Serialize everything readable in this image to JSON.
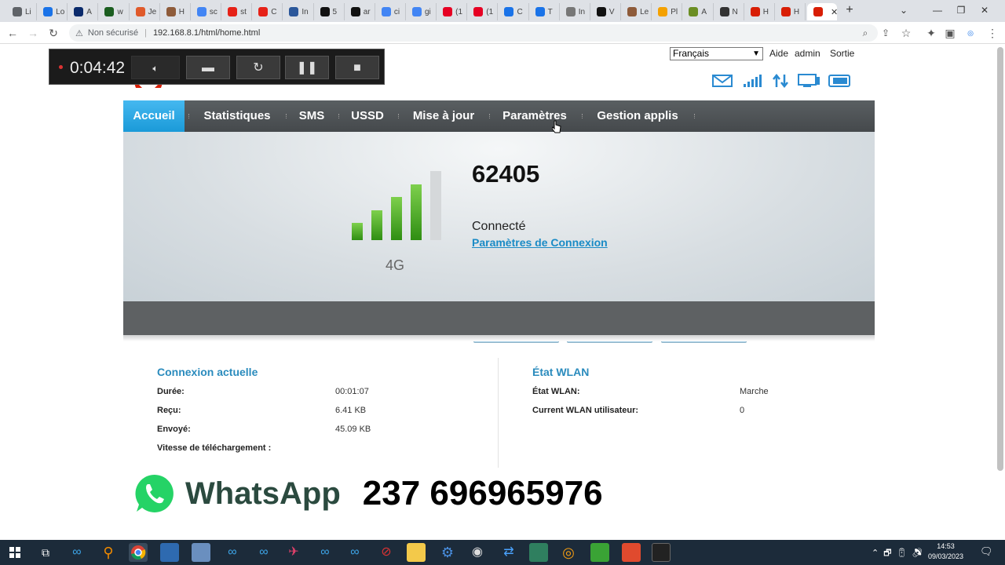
{
  "browser": {
    "tabs": [
      {
        "label": "Li",
        "color": "#5f6368"
      },
      {
        "label": "Lo",
        "color": "#1a73e8"
      },
      {
        "label": "A",
        "color": "#0a2a6b"
      },
      {
        "label": "w",
        "color": "#1b5e20"
      },
      {
        "label": "Je",
        "color": "#e05a2b"
      },
      {
        "label": "H",
        "color": "#8e5b3a"
      },
      {
        "label": "sc",
        "color": "#4285f4"
      },
      {
        "label": "st",
        "color": "#e62117"
      },
      {
        "label": "C",
        "color": "#e62117"
      },
      {
        "label": "In",
        "color": "#2b579a"
      },
      {
        "label": "5",
        "color": "#111111"
      },
      {
        "label": "ar",
        "color": "#111111"
      },
      {
        "label": "ci",
        "color": "#4285f4"
      },
      {
        "label": "gi",
        "color": "#4285f4"
      },
      {
        "label": "(1",
        "color": "#e60023"
      },
      {
        "label": "(1",
        "color": "#e60023"
      },
      {
        "label": "C",
        "color": "#1a73e8"
      },
      {
        "label": "T",
        "color": "#1a73e8"
      },
      {
        "label": "In",
        "color": "#777777"
      },
      {
        "label": "V",
        "color": "#111111"
      },
      {
        "label": "Le",
        "color": "#8e5b3a"
      },
      {
        "label": "Pl",
        "color": "#f4a100"
      },
      {
        "label": "A",
        "color": "#6b8e23"
      },
      {
        "label": "N",
        "color": "#333333"
      },
      {
        "label": "H",
        "color": "#d81e05"
      },
      {
        "label": "H",
        "color": "#d81e05"
      }
    ],
    "active_tab": {
      "label": "",
      "color": "#d81e05"
    },
    "address": {
      "security": "Non sécurisé",
      "url": "192.168.8.1/html/home.html"
    }
  },
  "recorder": {
    "time": "0:04:42"
  },
  "header": {
    "language": "Français",
    "links": [
      "Aide",
      "admin",
      "Sortie"
    ]
  },
  "nav": {
    "items": [
      "Accueil",
      "Statistiques",
      "SMS",
      "USSD",
      "Mise à jour",
      "Paramètres",
      "Gestion applis"
    ],
    "active": "Accueil"
  },
  "status": {
    "network_name": "62405",
    "connection_state": "Connecté",
    "connection_settings_link": "Paramètres de Connexion",
    "network_type": "4G",
    "signal_bars_on": 4,
    "signal_bars_total": 5
  },
  "current_connection": {
    "title": "Connexion actuelle",
    "rows": [
      {
        "label": "Durée:",
        "value": "00:01:07"
      },
      {
        "label": "Reçu:",
        "value": "6.41 KB"
      },
      {
        "label": "Envoyé:",
        "value": "45.09 KB"
      },
      {
        "label": "Vitesse de téléchargement :",
        "value": ""
      }
    ]
  },
  "wlan": {
    "title": "État WLAN",
    "rows": [
      {
        "label": "État WLAN:",
        "value": "Marche"
      },
      {
        "label": "Current WLAN utilisateur:",
        "value": "0"
      }
    ]
  },
  "overlay": {
    "app": "WhatsApp",
    "number": "237 696965976"
  },
  "taskbar": {
    "time": "14:53",
    "date": "09/03/2023"
  }
}
